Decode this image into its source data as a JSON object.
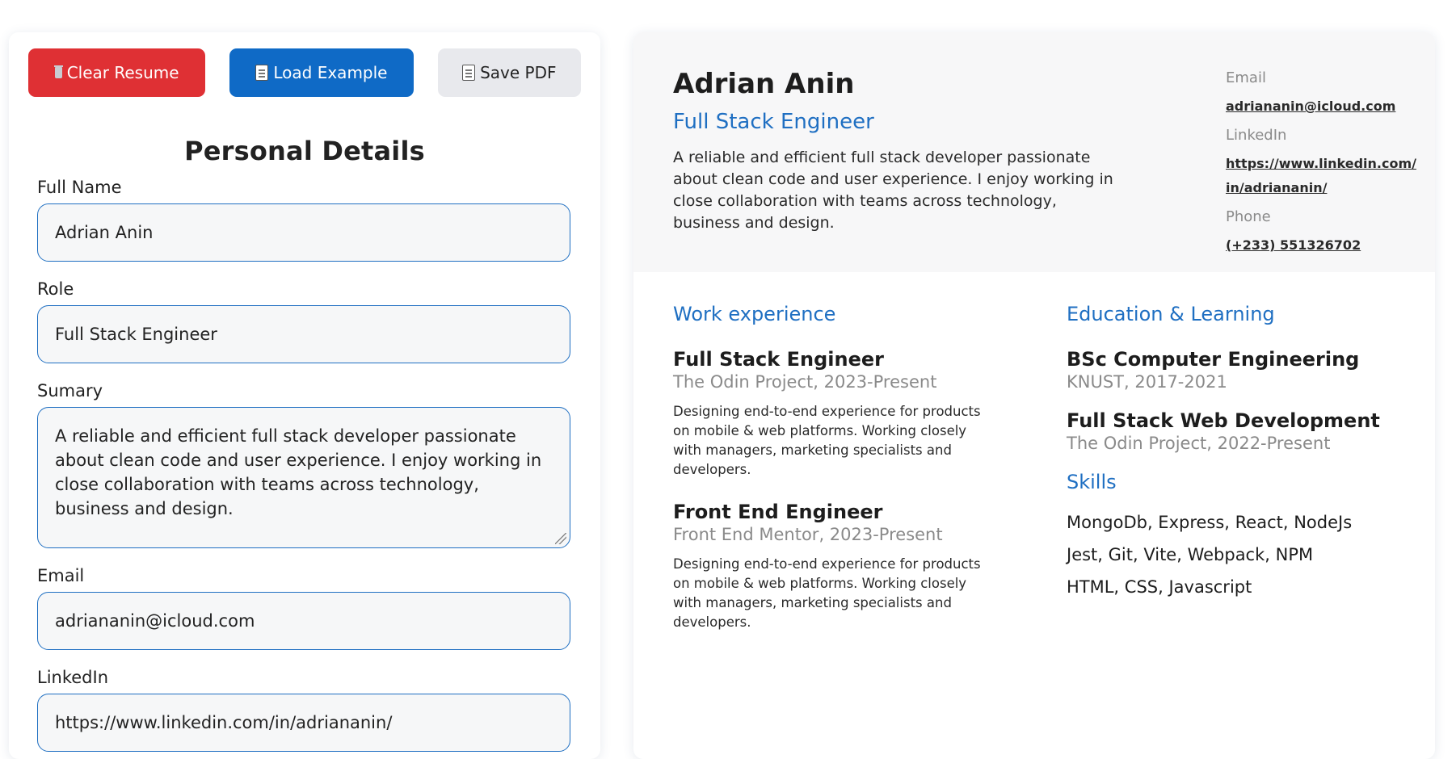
{
  "toolbar": {
    "clear_label": "Clear Resume",
    "load_label": "Load Example",
    "save_label": "Save PDF"
  },
  "form": {
    "title": "Personal Details",
    "fields": [
      {
        "label": "Full Name",
        "value": "Adrian Anin"
      },
      {
        "label": "Role",
        "value": "Full Stack Engineer"
      },
      {
        "label": "Sumary",
        "value": "A reliable and efficient full stack developer passionate about clean code and user experience. I enjoy working in close collaboration with teams across technology, business and design."
      },
      {
        "label": "Email",
        "value": "adriananin@icloud.com"
      },
      {
        "label": "LinkedIn",
        "value": "https://www.linkedin.com/in/adriananin/"
      }
    ]
  },
  "resume": {
    "name": "Adrian Anin",
    "role": "Full Stack Engineer",
    "summary": "A reliable and efficient full stack developer passionate about clean code and user experience. I enjoy working in close collaboration with teams across technology, business and design.",
    "contact": {
      "email_label": "Email",
      "email": "adriananin@icloud.com",
      "linkedin_label": "LinkedIn",
      "linkedin": "https://www.linkedin.com/in/adriananin/",
      "phone_label": "Phone",
      "phone": "(+233) 551326702"
    },
    "work": {
      "heading": "Work experience",
      "items": [
        {
          "title": "Full Stack Engineer",
          "meta": "The Odin Project, 2023-Present",
          "desc": "Designing end-to-end experience for products on mobile & web platforms. Working closely with managers, marketing specialists and developers."
        },
        {
          "title": "Front End Engineer",
          "meta": "Front End Mentor, 2023-Present",
          "desc": "Designing end-to-end experience for products on mobile & web platforms. Working closely with managers, marketing specialists and developers."
        }
      ]
    },
    "education": {
      "heading": "Education & Learning",
      "items": [
        {
          "title": "BSc Computer Engineering",
          "meta": "KNUST, 2017-2021"
        },
        {
          "title": "Full Stack Web Development",
          "meta": "The Odin Project, 2022-Present"
        }
      ]
    },
    "skills": {
      "heading": "Skills",
      "lines": [
        "MongoDb, Express, React, NodeJs",
        "Jest, Git, Vite, Webpack, NPM",
        "HTML, CSS, Javascript"
      ]
    }
  },
  "colors": {
    "clear_button": "#df3034",
    "load_button": "#0f6ac6",
    "accent": "#1f6fc2"
  }
}
